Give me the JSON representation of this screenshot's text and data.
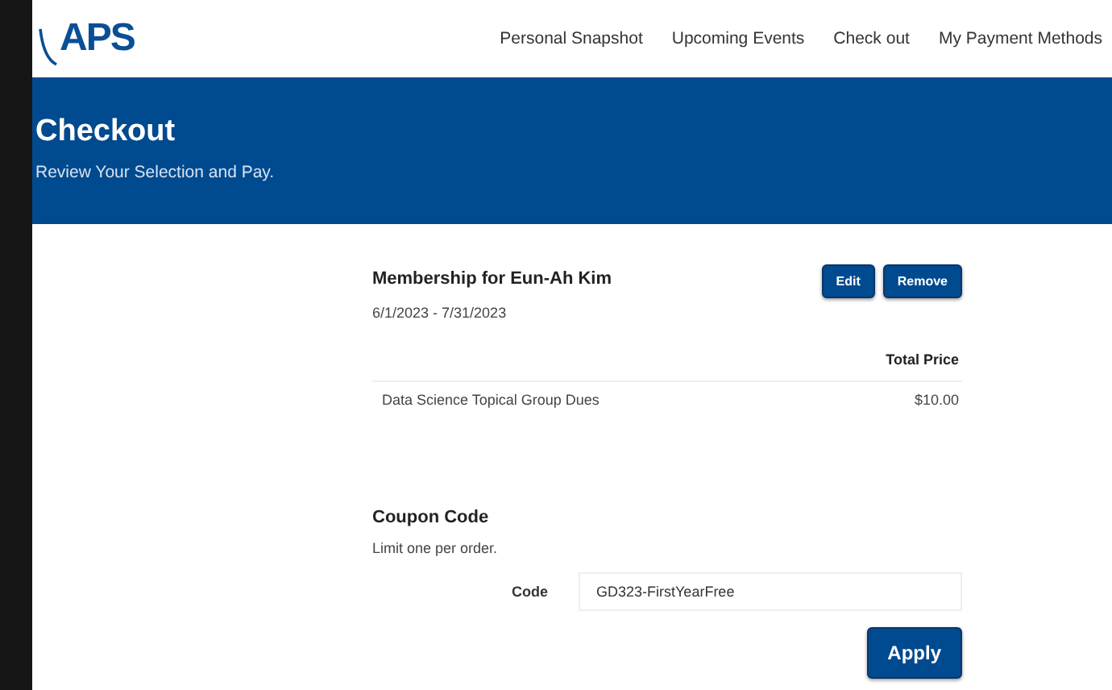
{
  "header": {
    "logo": "APS",
    "nav": [
      {
        "label": "Personal Snapshot"
      },
      {
        "label": "Upcoming Events"
      },
      {
        "label": "Check out"
      },
      {
        "label": "My Payment Methods"
      }
    ]
  },
  "banner": {
    "title": "Checkout",
    "subtitle": "Review Your Selection and Pay."
  },
  "membership": {
    "title": "Membership for Eun-Ah Kim",
    "dates": "6/1/2023 - 7/31/2023",
    "buttons": [
      "Edit",
      "Remove"
    ],
    "price_header": "Total Price",
    "items": [
      {
        "name": "Data Science Topical Group Dues",
        "price": "$10.00"
      }
    ]
  },
  "coupon": {
    "title": "Coupon Code",
    "note": "Limit one per order.",
    "label": "Code",
    "value": "GD323-FirstYearFree",
    "button": "Apply"
  }
}
